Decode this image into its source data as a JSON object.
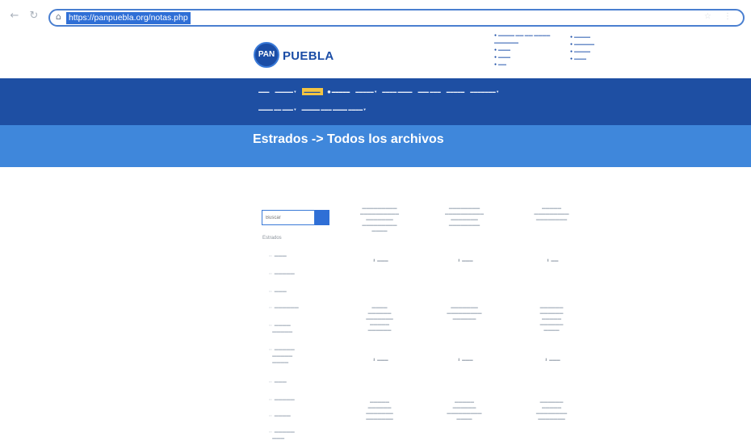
{
  "browser": {
    "back_icon": "arrow-left-icon",
    "reload_icon": "reload-icon",
    "url": "https://panpuebla.org/notas.php"
  },
  "header": {
    "logo_text": "PAN",
    "site_name": "PUEBLA"
  },
  "banner": {
    "title": "Estrados -> Todos los archivos"
  },
  "sidebar": {
    "search_placeholder": "Buscar",
    "section_title": "Estrados"
  },
  "documents": {
    "download_label": "Descargar"
  },
  "colors": {
    "nav_blue": "#1e4fa3",
    "banner_blue": "#3f87db",
    "url_highlight": "#2f6fd6"
  }
}
